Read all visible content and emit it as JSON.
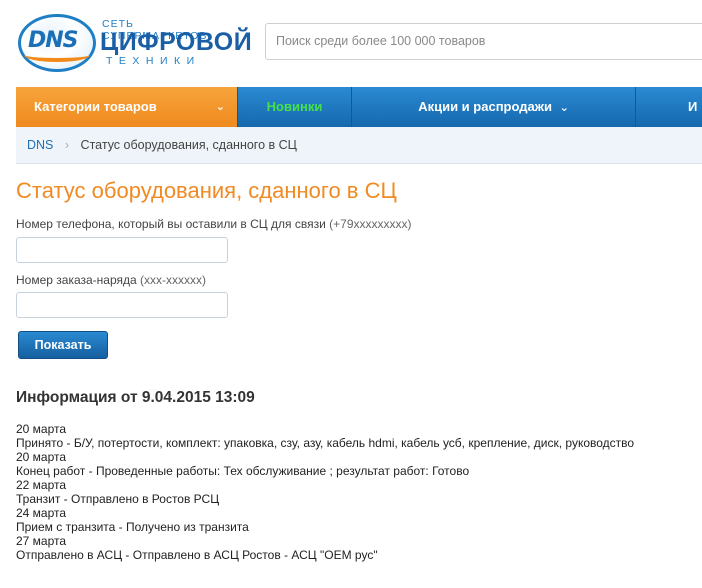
{
  "header": {
    "logo_dns": "DNS",
    "logo_line1": "СЕТЬ СУПЕРМАРКЕТОВ",
    "logo_line2": "ЦИФРОВОЙ",
    "logo_line3": "ТЕХНИКИ",
    "search_placeholder": "Поиск среди более 100 000 товаров"
  },
  "nav": {
    "categories": "Категории товаров",
    "new": "Новинки",
    "sales": "Акции и распродажи",
    "last": "И"
  },
  "breadcrumb": {
    "home": "DNS",
    "current": "Статус оборудования, сданного в СЦ"
  },
  "form": {
    "title": "Статус оборудования, сданного в СЦ",
    "phone_label": "Номер телефона, который вы оставили в СЦ для связи",
    "phone_hint": "(+79xxxxxxxxx)",
    "phone_value": "",
    "order_label": "Номер заказа-наряда",
    "order_hint": "(xxx-xxxxxx)",
    "order_value": "",
    "submit": "Показать"
  },
  "info": {
    "title": "Информация от 9.04.2015 13:09",
    "lines": [
      "20 марта",
      "Принято - Б/У, потертости, комплект: упаковка, сзу, азу, кабель hdmi, кабель усб, крепление, диск, руководство",
      "20 марта",
      "Конец работ - Проведенные работы: Тех обслуживание ; результат работ: Готово",
      "22 марта",
      "Транзит - Отправлено в Ростов РСЦ",
      "24 марта",
      "Прием с транзита - Получено из транзита",
      "27 марта",
      "Отправлено в АСЦ - Отправлено в АСЦ Ростов - АСЦ \"ОЕМ рус\""
    ]
  },
  "colors": {
    "accent_orange": "#f08a23",
    "nav_blue": "#1f78c0",
    "new_green": "#46e04a"
  }
}
